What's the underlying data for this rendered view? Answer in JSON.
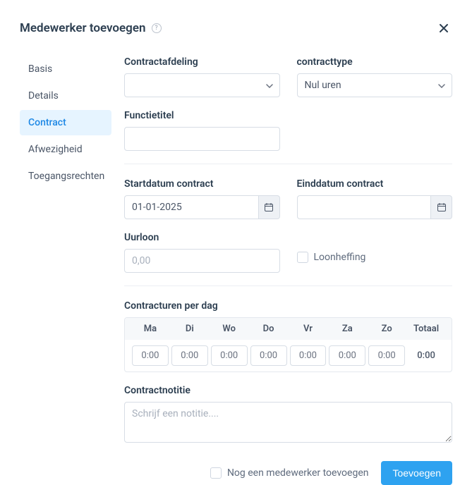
{
  "header": {
    "title": "Medewerker toevoegen"
  },
  "sidebar": {
    "tabs": [
      {
        "label": "Basis"
      },
      {
        "label": "Details"
      },
      {
        "label": "Contract"
      },
      {
        "label": "Afwezigheid"
      },
      {
        "label": "Toegangsrechten"
      }
    ],
    "active_index": 2
  },
  "fields": {
    "contract_dept_label": "Contractafdeling",
    "contract_dept_value": "",
    "contract_type_label": "contracttype",
    "contract_type_value": "Nul uren",
    "function_title_label": "Functietitel",
    "function_title_value": "",
    "start_date_label": "Startdatum contract",
    "start_date_value": "01-01-2025",
    "end_date_label": "Einddatum contract",
    "end_date_value": "",
    "hourly_wage_label": "Uurloon",
    "hourly_wage_placeholder": "0,00",
    "wage_tax_label": "Loonheffing",
    "hours_label": "Contracturen per dag",
    "note_label": "Contractnotitie",
    "note_placeholder": "Schrijf een notitie...."
  },
  "hours": {
    "headers": [
      "Ma",
      "Di",
      "Wo",
      "Do",
      "Vr",
      "Za",
      "Zo",
      "Totaal"
    ],
    "values": [
      "0:00",
      "0:00",
      "0:00",
      "0:00",
      "0:00",
      "0:00",
      "0:00"
    ],
    "total": "0:00"
  },
  "footer": {
    "add_another_label": "Nog een medewerker toevoegen",
    "submit_label": "Toevoegen"
  }
}
